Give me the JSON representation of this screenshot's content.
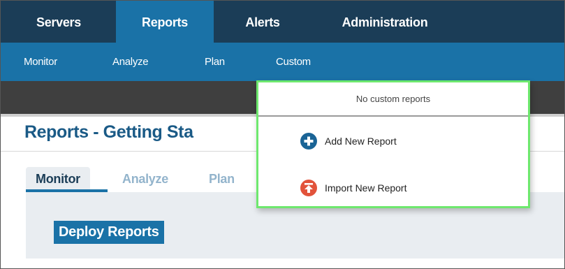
{
  "top_nav": {
    "tabs": [
      {
        "label": "Servers",
        "active": false
      },
      {
        "label": "Reports",
        "active": true
      },
      {
        "label": "Alerts",
        "active": false
      },
      {
        "label": "Administration",
        "active": false
      }
    ]
  },
  "sub_nav": {
    "items": [
      "Monitor",
      "Analyze",
      "Plan",
      "Custom"
    ]
  },
  "page": {
    "title": "Reports - Getting Sta"
  },
  "content_tabs": [
    {
      "label": "Monitor",
      "active": true
    },
    {
      "label": "Analyze",
      "active": false
    },
    {
      "label": "Plan",
      "active": false
    }
  ],
  "deploy_button": {
    "label": "Deploy Reports"
  },
  "custom_dropdown": {
    "header": "No custom reports",
    "items": [
      {
        "label": "Add New Report",
        "icon": "plus-circle-icon"
      },
      {
        "label": "Import New Report",
        "icon": "import-circle-icon"
      }
    ]
  },
  "colors": {
    "top_nav_bg": "#1b3d57",
    "accent_blue": "#1a72a7",
    "dropdown_highlight": "#6ee86e",
    "add_icon": "#1a6496",
    "import_icon": "#e2533b"
  }
}
